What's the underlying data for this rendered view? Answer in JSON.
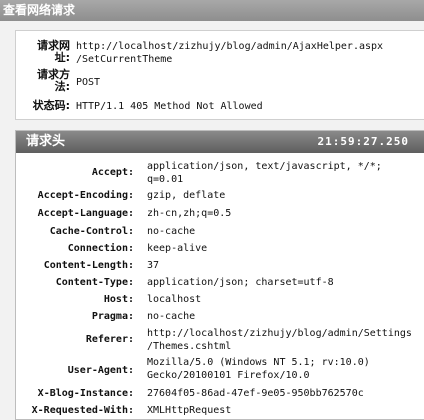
{
  "window": {
    "title": "查看网络请求"
  },
  "request": {
    "url_label_line1": "请求网",
    "url_label_line2": "址:",
    "url_value_line1": "http://localhost/zizhujy/blog/admin/AjaxHelper.aspx",
    "url_value_line2": "/SetCurrentTheme",
    "method_label_line1": "请求方",
    "method_label_line2": "法:",
    "method_value": "POST",
    "status_label": "状态码:",
    "status_value": "HTTP/1.1 405 Method Not Allowed"
  },
  "headers": {
    "title": "请求头",
    "time": "21:59:27.250",
    "rows": [
      {
        "name": "Accept:",
        "value_line1": "application/json, text/javascript, */*;",
        "value_line2": "q=0.01"
      },
      {
        "name": "Accept-Encoding:",
        "value_line1": "gzip, deflate"
      },
      {
        "name": "Accept-Language:",
        "value_line1": "zh-cn,zh;q=0.5"
      },
      {
        "name": "Cache-Control:",
        "value_line1": "no-cache"
      },
      {
        "name": "Connection:",
        "value_line1": "keep-alive"
      },
      {
        "name": "Content-Length:",
        "value_line1": "37"
      },
      {
        "name": "Content-Type:",
        "value_line1": "application/json; charset=utf-8"
      },
      {
        "name": "Host:",
        "value_line1": "localhost"
      },
      {
        "name": "Pragma:",
        "value_line1": "no-cache"
      },
      {
        "name": "Referer:",
        "value_line1": "http://localhost/zizhujy/blog/admin/Settings",
        "value_line2": "/Themes.cshtml"
      },
      {
        "name": "User-Agent:",
        "value_line1": "Mozilla/5.0 (Windows NT 5.1; rv:10.0)",
        "value_line2": "Gecko/20100101 Firefox/10.0"
      },
      {
        "name": "X-Blog-Instance:",
        "value_line1": "27604f05-86ad-47ef-9e05-950bb762570c"
      },
      {
        "name": "X-Requested-With:",
        "value_line1": "XMLHttpRequest"
      }
    ]
  }
}
